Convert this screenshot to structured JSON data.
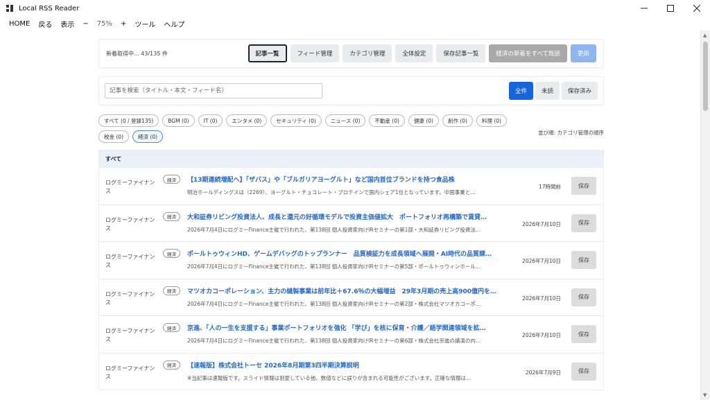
{
  "window": {
    "title": "Local RSS Reader",
    "icon": "app-grid-icon",
    "controls": [
      "minimize-icon",
      "maximize-icon",
      "close-icon"
    ]
  },
  "menu": {
    "items": [
      {
        "label": "HOME",
        "dim": false
      },
      {
        "label": "戻る",
        "dim": false
      },
      {
        "label": "表示",
        "dim": false
      },
      {
        "label": "−",
        "dim": false
      },
      {
        "label": "75%",
        "dim": true
      },
      {
        "label": "+",
        "dim": false
      },
      {
        "label": "ツール",
        "dim": false
      },
      {
        "label": "ヘルプ",
        "dim": false
      }
    ]
  },
  "toolbar": {
    "status": "新着取得中... 43/135 件",
    "buttons": {
      "articles": "記事一覧",
      "feeds": "フィード管理",
      "categories": "カテゴリ管理",
      "settings": "全体設定",
      "saved": "保存記事一覧",
      "mark_all_read": "経済の新着をすべて既読",
      "refresh": "更新"
    }
  },
  "search": {
    "placeholder": "記事を検索（タイトル・本文・フィード名）",
    "value": "",
    "filters": [
      "全件",
      "未読",
      "保存済み"
    ],
    "selected_filter": "全件"
  },
  "categories": {
    "chips": [
      "すべて (0 / 登録135)",
      "BGM (0)",
      "IT (0)",
      "エンタメ (0)",
      "セキュリティ (0)",
      "ニュース (0)",
      "不動産 (0)",
      "健康 (0)",
      "創作 (0)",
      "料理 (0)",
      "税金 (0)",
      "経済 (0)"
    ],
    "selected": "経済 (0)",
    "sort_label": "並び順: カテゴリ管理の順序"
  },
  "list": {
    "header": "すべて",
    "save_label": "保存",
    "articles": [
      {
        "source": "ログミーファイナンス",
        "category": "経済",
        "title": "【13期連続増配へ】「ザバス」や「ブルガリアヨーグルト」など国内首位ブランドを持つ食品株",
        "summary": "明治ホールディングスは（2269）、ヨーグルト・チョコレート・プロテインで国内シェア1位となっています。中国事業と…",
        "date": "17時間前"
      },
      {
        "source": "ログミーファイナンス",
        "category": "経済",
        "title": "大和証券リビング投資法人、成長と還元の好循環モデルで投資主価値拡大　ポートフォリオ再構築で賃貸…",
        "summary": "2026年7月4日にログミーFinance主催で行われた、第138回 個人投資家向けIRセミナーの第1部・大和証券リビング投資法…",
        "date": "2026年7月10日"
      },
      {
        "source": "ログミーファイナンス",
        "category": "経済",
        "title": "ポールトゥウィンHD、ゲームデバッグのトップランナー　品質検証力を成長領域へ展開・AI時代の品質課…",
        "summary": "2026年7月4日にログミーFinance主催で行われた、第138回 個人投資家向けIRセミナーの第5部・ポールトゥウィンホール…",
        "date": "2026年7月10日"
      },
      {
        "source": "ログミーファイナンス",
        "category": "経済",
        "title": "マツオカコーポレーション、主力の縫製事業は前年比＋67.6％の大幅増益　29年3月期の売上高900億円を…",
        "summary": "2026年7月4日にログミーFinance主催で行われた、第138回 個人投資家向けIRセミナーの第2部・株式会社マツオカコーポ…",
        "date": "2026年7月10日"
      },
      {
        "source": "ログミーファイナンス",
        "category": "経済",
        "title": "京進、「人の一生を支援する」事業ポートフォリオを強化 「学び」を核に保育・介護／語学関連領域を拡…",
        "summary": "2026年7月4日にログミーFinance主催で行われた、第138回 個人投資家向けIRセミナーの第6部・株式会社京進の講演の内…",
        "date": "2026年7月10日"
      },
      {
        "source": "ログミーファイナンス",
        "category": "経済",
        "title": "【速報版】株式会社トーセ 2026年8月期第3四半期決算説明",
        "summary": "※当記事は速報版です。スライド情報は割愛している他、数値などに誤りが含まれる可能性がございます。正確な情報は…",
        "date": "2026年7月9日"
      }
    ]
  }
}
